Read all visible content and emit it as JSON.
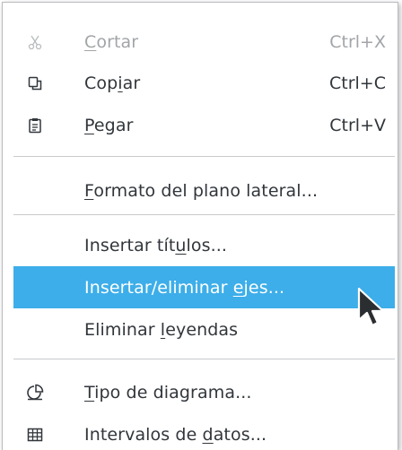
{
  "menu": {
    "items": [
      {
        "id": "cut",
        "pre": "",
        "mnemonic": "C",
        "post": "ortar",
        "shortcut": "Ctrl+X",
        "icon": "scissors-icon",
        "disabled": true
      },
      {
        "id": "copy",
        "pre": "Cop",
        "mnemonic": "i",
        "post": "ar",
        "shortcut": "Ctrl+C",
        "icon": "copy-icon",
        "disabled": false
      },
      {
        "id": "paste",
        "pre": "",
        "mnemonic": "P",
        "post": "egar",
        "shortcut": "Ctrl+V",
        "icon": "clipboard-icon",
        "disabled": false
      },
      {
        "id": "format-side-wall",
        "pre": "",
        "mnemonic": "F",
        "post": "ormato del plano lateral...",
        "shortcut": "",
        "icon": "",
        "disabled": false
      },
      {
        "id": "insert-titles",
        "pre": "Insertar tít",
        "mnemonic": "u",
        "post": "los...",
        "shortcut": "",
        "icon": "",
        "disabled": false
      },
      {
        "id": "insert-delete-axes",
        "pre": "Insertar/eliminar ",
        "mnemonic": "e",
        "post": "jes...",
        "shortcut": "",
        "icon": "",
        "disabled": false,
        "selected": true
      },
      {
        "id": "delete-legends",
        "pre": "Eliminar ",
        "mnemonic": "l",
        "post": "eyendas",
        "shortcut": "",
        "icon": "",
        "disabled": false
      },
      {
        "id": "chart-type",
        "pre": "",
        "mnemonic": "T",
        "post": "ipo de diagrama...",
        "shortcut": "",
        "icon": "chart-type-icon",
        "disabled": false
      },
      {
        "id": "data-ranges",
        "pre": "Intervalos de ",
        "mnemonic": "d",
        "post": "atos...",
        "shortcut": "",
        "icon": "data-table-icon",
        "disabled": false
      }
    ]
  },
  "colors": {
    "selection": "#3daee9",
    "text": "#31363b",
    "disabled_text": "#a2a5a8"
  }
}
